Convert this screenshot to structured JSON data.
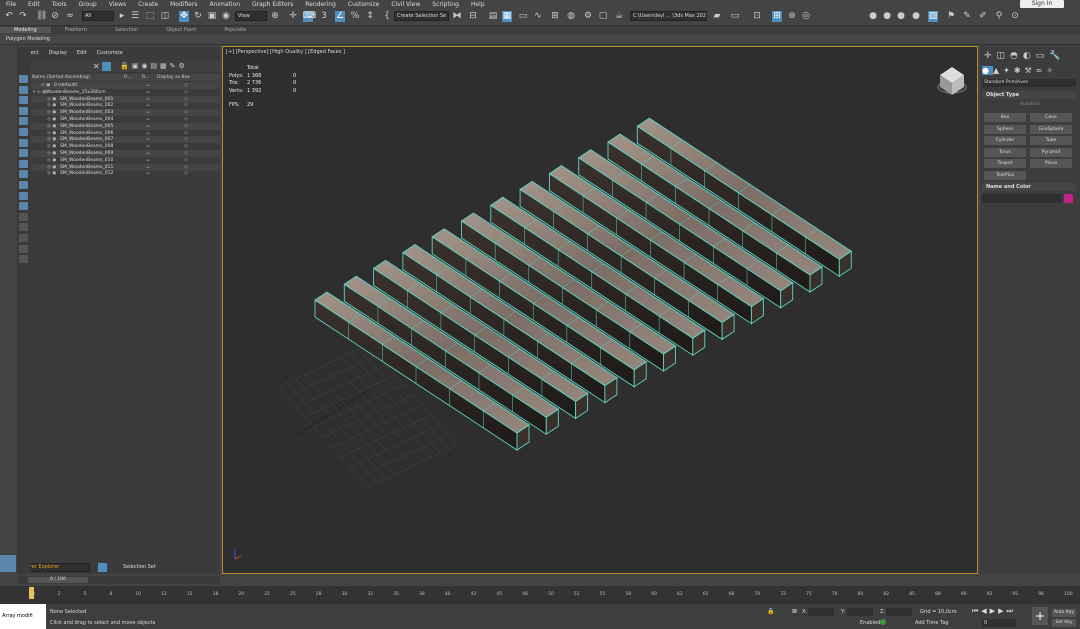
{
  "menu": [
    "File",
    "Edit",
    "Tools",
    "Group",
    "Views",
    "Create",
    "Modifiers",
    "Animation",
    "Graph Editors",
    "Rendering",
    "Customize",
    "Civil View",
    "Scripting",
    "Help"
  ],
  "sign_in": "Sign In",
  "toolbar": {
    "filter": "All",
    "view": "View",
    "selection_set": "Create Selection Se",
    "path": "C:\\Users\\leyl ... \\3ds Max 2024"
  },
  "ribbon_tabs": [
    "Modeling",
    "Freeform",
    "Selection",
    "Object Paint",
    "Populate"
  ],
  "ribbon_sub": "Polygon Modeling",
  "explorer": {
    "menu": [
      "Select",
      "Display",
      "Edit",
      "Customize"
    ],
    "col_name": "Name (Sorted Ascending)",
    "col_fr": "Fr...",
    "col_r": "R...",
    "col_box": "Display as Box",
    "rows": [
      "0 (default)",
      "WoodenBeams_25x300cm",
      "SM_WoodenBeams_001",
      "SM_WoodenBeams_002",
      "SM_WoodenBeams_003",
      "SM_WoodenBeams_004",
      "SM_WoodenBeams_005",
      "SM_WoodenBeams_006",
      "SM_WoodenBeams_007",
      "SM_WoodenBeams_008",
      "SM_WoodenBeams_009",
      "SM_WoodenBeams_010",
      "SM_WoodenBeams_011",
      "SM_WoodenBeams_012"
    ],
    "layer_label": "Layer Explorer",
    "selection_set": "Selection Set",
    "frame": "0 / 100"
  },
  "viewport": {
    "label": "[+] [Perspective] [High Quality ] [Edged Faces ]",
    "stats": {
      "total": "Total",
      "polys_label": "Polys:",
      "polys": "1 368",
      "polys_sel": "0",
      "tris_label": "Tris:",
      "tris": "2 736",
      "tris_sel": "0",
      "verts_label": "Verts:",
      "verts": "1 392",
      "verts_sel": "0",
      "fps_label": "FPS:",
      "fps": "29"
    }
  },
  "panel": {
    "category": "Standard Primitives",
    "object_type": "Object Type",
    "autogrid": "AutoGrid",
    "buttons": [
      "Box",
      "Cone",
      "Sphere",
      "GeoSphere",
      "Cylinder",
      "Tube",
      "Torus",
      "Pyramid",
      "Teapot",
      "Plane",
      "TextPlus"
    ],
    "name_color": "Name and Color",
    "color": "#c2228a"
  },
  "timeline": {
    "ticks": [
      "0",
      "2",
      "5",
      "8",
      "10",
      "12",
      "15",
      "18",
      "20",
      "22",
      "25",
      "28",
      "30",
      "32",
      "35",
      "38",
      "40",
      "42",
      "45",
      "48",
      "50",
      "52",
      "55",
      "58",
      "60",
      "62",
      "65",
      "68",
      "70",
      "72",
      "75",
      "78",
      "80",
      "82",
      "85",
      "88",
      "90",
      "92",
      "95",
      "98",
      "100"
    ]
  },
  "status": {
    "mini": "Array modifi",
    "msg1": "None Selected",
    "msg2": "Click and drag to select and move objects",
    "x": "X:",
    "y": "Y:",
    "z": "Z:",
    "grid": "Grid = 10,0cm",
    "enabled": "Enabled:",
    "add_tag": "Add Time Tag",
    "autokey": "Auto Key",
    "setkey": "Set Key",
    "frame": "0"
  }
}
